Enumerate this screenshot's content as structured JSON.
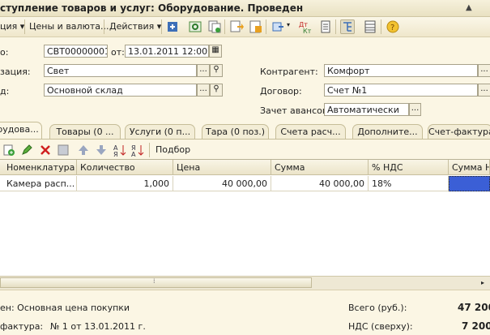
{
  "window": {
    "title": "ступление товаров и услуг: Оборудование. Проведен"
  },
  "toolbar": {
    "menu_operation": "ция ▾",
    "menu_prices": "Цены и валюта...",
    "menu_actions": "Действия ▾"
  },
  "header": {
    "number_label": "о:",
    "number_value": "СВТ00000001",
    "date_label": "от:",
    "date_value": "13.01.2011 12:00:00",
    "org_label": "зация:",
    "org_value": "Свет",
    "warehouse_label": "д:",
    "warehouse_value": "Основной склад",
    "counterparty_label": "Контрагент:",
    "counterparty_value": "Комфорт",
    "contract_label": "Договор:",
    "contract_value": "Счет №1",
    "advance_label": "Зачет авансов:",
    "advance_value": "Автоматически"
  },
  "tabs": [
    {
      "label": "рудова..."
    },
    {
      "label": "Товары (0 ..."
    },
    {
      "label": "Услуги (0 п..."
    },
    {
      "label": "Тара (0 поз.)"
    },
    {
      "label": "Счета расч..."
    },
    {
      "label": "Дополните..."
    },
    {
      "label": "Счет-фактура"
    }
  ],
  "grid_toolbar": {
    "selection_label": "Подбор"
  },
  "table": {
    "columns": [
      "Номенклатура",
      "Количество",
      "Цена",
      "Сумма",
      "% НДС",
      "Сумма Н"
    ],
    "rows": [
      {
        "name": "Камера расп...",
        "qty": "1,000",
        "price": "40 000,00",
        "sum": "40 000,00",
        "vat_rate": "18%",
        "vat_sum": ""
      }
    ]
  },
  "footer": {
    "price_type": "ен: Основная цена покупки",
    "invoice_label": "фактура:",
    "invoice_value": "№ 1 от 13.01.2011 г.",
    "total_label": "Всего (руб.):",
    "total_value": "47 200,",
    "vat_label": "НДС (сверху):",
    "vat_value": "7 200,"
  },
  "colors": {
    "background": "#fbf6e4",
    "selection": "#3b5fd6",
    "accent": "#e8a020"
  },
  "icons": [
    "post-icon",
    "refresh-icon",
    "copy-icon",
    "save-icon",
    "print-icon",
    "go-icon",
    "dt-kt-icon",
    "report-icon",
    "structure-icon",
    "columns-icon",
    "help-icon",
    "calendar-icon",
    "magnifier-icon",
    "add-row-icon",
    "edit-icon",
    "delete-icon",
    "end-edit-icon",
    "move-up-icon",
    "move-down-icon",
    "sort-asc-icon",
    "sort-desc-icon"
  ]
}
